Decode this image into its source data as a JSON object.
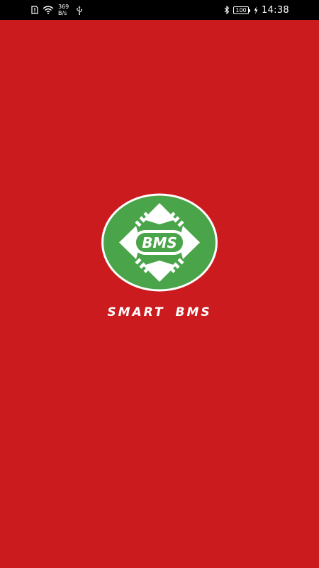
{
  "status_bar": {
    "net_speed_value": "369",
    "net_speed_unit": "B/s",
    "battery_level": "100",
    "time": "14:38",
    "icons": [
      "sim-alert-icon",
      "wifi-icon",
      "usb-icon",
      "bluetooth-icon",
      "battery-icon",
      "charging-icon"
    ]
  },
  "splash": {
    "background_color": "#cb1b1e",
    "logo_text": "BMS",
    "logo_colors": {
      "circle": "#4aa44a",
      "rim": "#ffffff",
      "chip": "#ffffff"
    },
    "app_name": "SMART BMS"
  }
}
